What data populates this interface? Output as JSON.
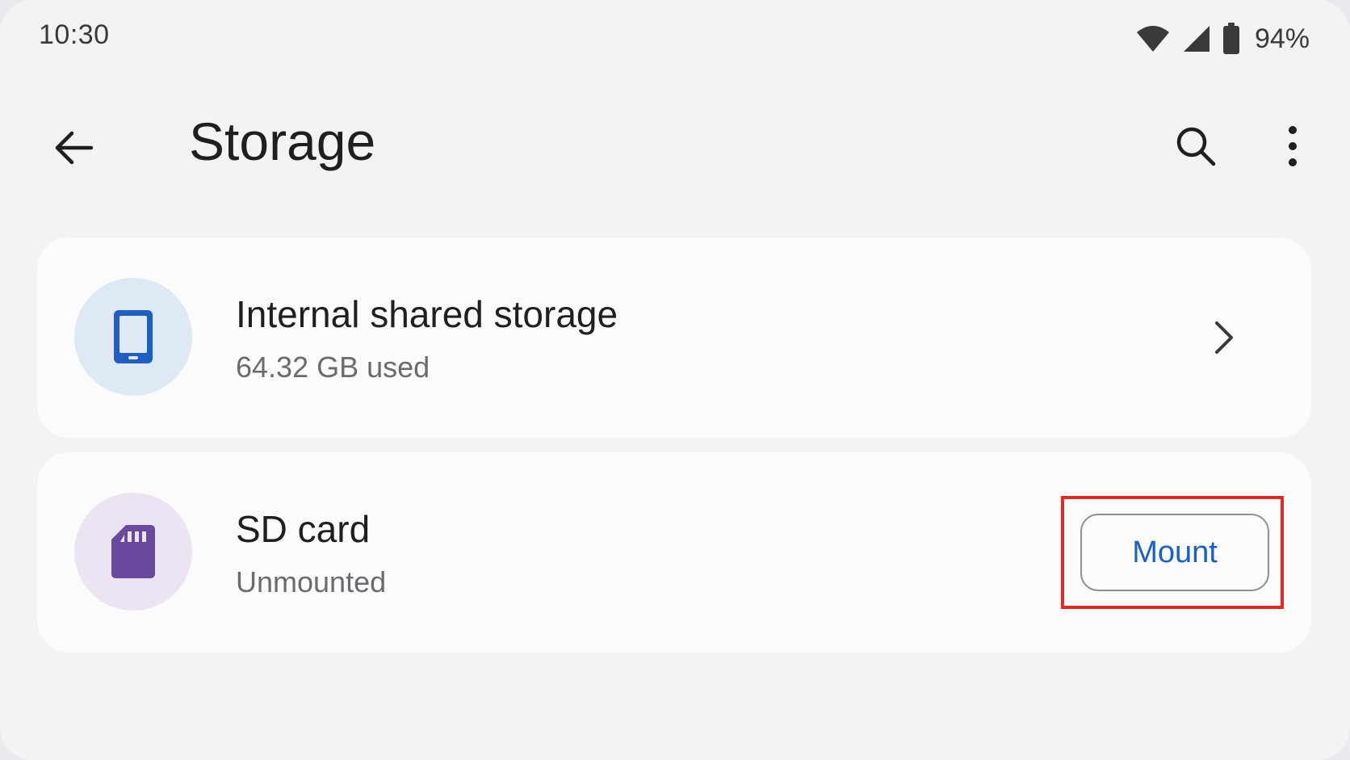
{
  "status_bar": {
    "time": "10:30",
    "battery_percent": "94%",
    "icons": [
      "wifi-icon",
      "cellular-signal-icon",
      "battery-icon"
    ]
  },
  "app_bar": {
    "title": "Storage",
    "back_icon": "arrow-left-icon",
    "search_icon": "search-icon",
    "more_icon": "more-vert-icon"
  },
  "storage_items": [
    {
      "title": "Internal shared storage",
      "subtitle": "64.32 GB used",
      "icon": "smartphone-icon",
      "icon_color": "#1f5fc4",
      "avatar_bg": "#dfe8f5",
      "trailing": "chevron-right-icon"
    },
    {
      "title": "SD card",
      "subtitle": "Unmounted",
      "icon": "sd-card-icon",
      "icon_color": "#6a4a9e",
      "avatar_bg": "#ece4f2",
      "action_label": "Mount"
    }
  ],
  "colors": {
    "background": "#f3f3f6",
    "card": "#fbfbfc",
    "accent_blue": "#1b5fc9",
    "highlight_red": "#e22a22"
  }
}
